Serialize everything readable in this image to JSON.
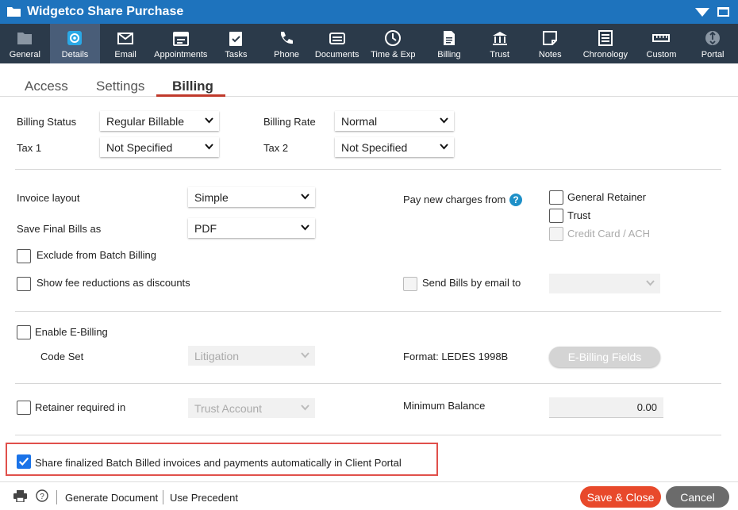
{
  "window": {
    "title": "Widgetco Share Purchase"
  },
  "nav": [
    {
      "label": "General",
      "icon": "folder-icon"
    },
    {
      "label": "Details",
      "icon": "gear-icon",
      "active": true
    },
    {
      "label": "Email",
      "icon": "envelope-icon"
    },
    {
      "label": "Appointments",
      "icon": "calendar-icon"
    },
    {
      "label": "Tasks",
      "icon": "clipboard-check-icon"
    },
    {
      "label": "Phone",
      "icon": "phone-icon"
    },
    {
      "label": "Documents",
      "icon": "documents-icon"
    },
    {
      "label": "Time & Exp",
      "icon": "clock-icon"
    },
    {
      "label": "Billing",
      "icon": "invoice-icon"
    },
    {
      "label": "Trust",
      "icon": "bank-icon"
    },
    {
      "label": "Notes",
      "icon": "note-icon"
    },
    {
      "label": "Chronology",
      "icon": "list-icon"
    },
    {
      "label": "Custom",
      "icon": "ruler-icon"
    },
    {
      "label": "Portal",
      "icon": "portal-icon"
    }
  ],
  "tabs": {
    "access": "Access",
    "settings": "Settings",
    "billing": "Billing"
  },
  "form": {
    "billing_status_label": "Billing Status",
    "billing_status_value": "Regular Billable",
    "billing_rate_label": "Billing Rate",
    "billing_rate_value": "Normal",
    "tax1_label": "Tax 1",
    "tax1_value": "Not Specified",
    "tax2_label": "Tax 2",
    "tax2_value": "Not Specified",
    "invoice_layout_label": "Invoice layout",
    "invoice_layout_value": "Simple",
    "save_final_label": "Save Final Bills as",
    "save_final_value": "PDF",
    "pay_new_label": "Pay new charges from",
    "general_retainer": "General Retainer",
    "trust": "Trust",
    "credit_card": "Credit Card / ACH",
    "exclude_batch": "Exclude from Batch Billing",
    "show_fee": "Show fee reductions as discounts",
    "send_bills": "Send Bills by email to",
    "enable_ebilling": "Enable E-Billing",
    "code_set_label": "Code Set",
    "code_set_value": "Litigation",
    "format_label": "Format: LEDES 1998B",
    "ebilling_fields": "E-Billing Fields",
    "retainer_required": "Retainer required in",
    "retainer_value": "Trust Account",
    "min_balance_label": "Minimum Balance",
    "min_balance_value": "0.00",
    "share_label": "Share finalized Batch Billed invoices and payments automatically in Client Portal",
    "share_checked": true
  },
  "footer": {
    "generate": "Generate Document",
    "precedent": "Use Precedent",
    "save_close": "Save & Close",
    "cancel": "Cancel"
  },
  "colors": {
    "titlebar": "#1e73bd",
    "navbar": "#2b3a4a",
    "active_nav": "#495d78",
    "accent_red": "#e8492b",
    "tab_underline": "#c0392b"
  }
}
